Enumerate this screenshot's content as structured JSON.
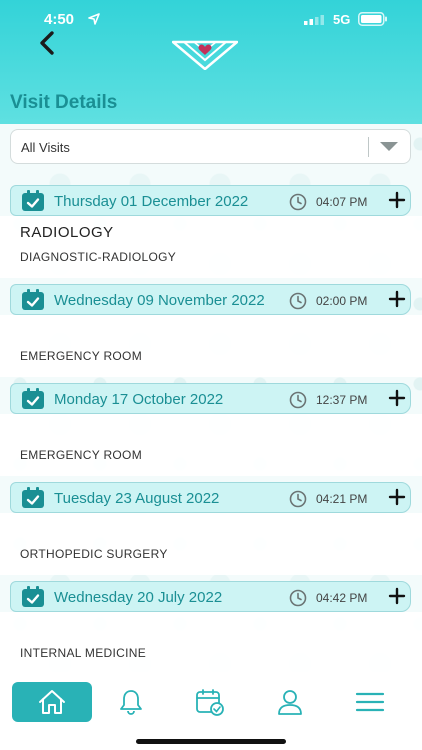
{
  "status_bar": {
    "time": "4:50",
    "network": "5G"
  },
  "header": {
    "title": "Visit Details"
  },
  "filter": {
    "selected": "All Visits"
  },
  "visits": [
    {
      "date": "Thursday 01 December 2022",
      "time": "04:07 PM",
      "title": "RADIOLOGY",
      "subtitle": "DIAGNOSTIC-RADIOLOGY"
    },
    {
      "date": "Wednesday 09 November 2022",
      "time": "02:00 PM",
      "title": "",
      "subtitle": "EMERGENCY ROOM"
    },
    {
      "date": "Monday 17 October 2022",
      "time": "12:37 PM",
      "title": "",
      "subtitle": "EMERGENCY ROOM"
    },
    {
      "date": "Tuesday 23 August 2022",
      "time": "04:21 PM",
      "title": "",
      "subtitle": "ORTHOPEDIC SURGERY"
    },
    {
      "date": "Wednesday 20 July 2022",
      "time": "04:42 PM",
      "title": "",
      "subtitle": "INTERNAL MEDICINE"
    }
  ],
  "nav": [
    "home-icon",
    "bell-icon",
    "calendar-check-icon",
    "user-icon",
    "menu-icon"
  ],
  "colors": {
    "accent": "#29b2b6",
    "header": "#33d3d8",
    "text_teal": "#1a8f94"
  }
}
